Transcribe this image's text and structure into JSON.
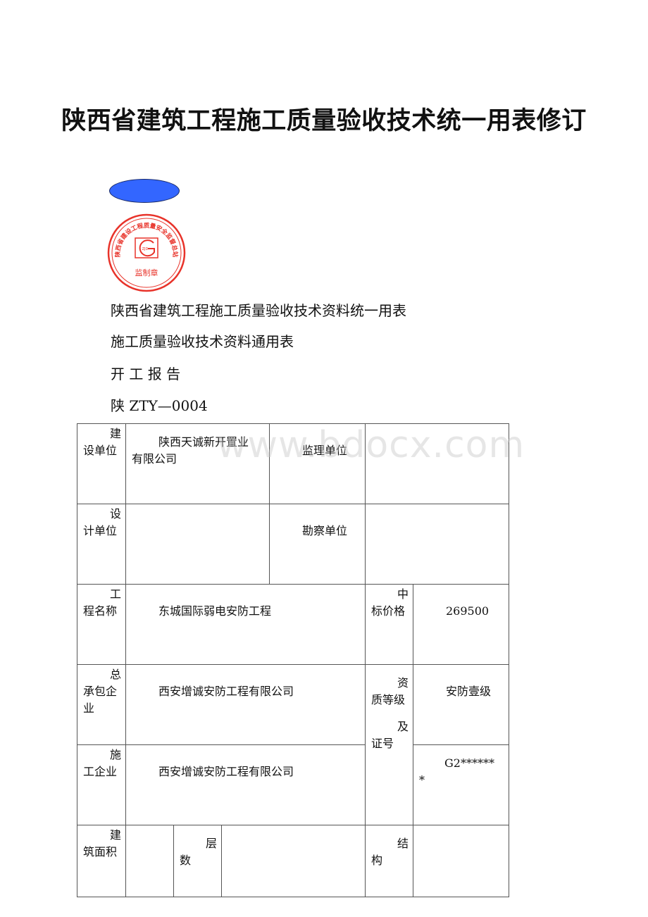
{
  "document": {
    "title": "陕西省建筑工程施工质量验收技术统一用表修订",
    "stamp": {
      "ring_text": "陕西省建设工程质量安全监督总站",
      "logo_text": "ZJD",
      "bottom_text": "监制章",
      "color": "#e8332a"
    },
    "oval_color": "#3366ff",
    "lines": [
      "陕西省建筑工程施工质量验收技术资料统一用表",
      "施工质量验收技术资料通用表",
      "开 工 报 告",
      "陕 ZTY—0004"
    ],
    "watermark": "www.bdocx.com"
  },
  "form": {
    "construction_unit_label": {
      "first": "建",
      "rest": "设单位"
    },
    "construction_unit_value": {
      "first": "陕西天诚新开置业",
      "rest": "有限公司"
    },
    "supervision_unit_label": "监理单位",
    "supervision_unit_value": "",
    "design_unit_label": {
      "first": "设",
      "rest": "计单位"
    },
    "design_unit_value": "",
    "survey_unit_label": "勘察单位",
    "survey_unit_value": "",
    "project_name_label": {
      "first": "工",
      "rest": "程名称"
    },
    "project_name_value": "东城国际弱电安防工程",
    "bid_price_label": {
      "first": "中",
      "rest": "标价格"
    },
    "bid_price_value": "269500",
    "general_contractor_label": {
      "first": "总",
      "rest": "承包企业"
    },
    "general_contractor_value": "西安增诚安防工程有限公司",
    "qualification_label": {
      "first": "资",
      "rest": "质等级"
    },
    "qualification_value": "安防壹级",
    "cert_label": {
      "first": "及",
      "rest": "证号"
    },
    "cert_value": {
      "first": "G2******",
      "rest": "*"
    },
    "builder_label": {
      "first": "施",
      "rest": "工企业"
    },
    "builder_value": "西安增诚安防工程有限公司",
    "area_label": {
      "first": "建",
      "rest": "筑面积"
    },
    "area_value": "",
    "floors_label": {
      "first": "层",
      "rest": "数"
    },
    "floors_value": "",
    "structure_label": {
      "first": "结",
      "rest": "构"
    },
    "structure_value": ""
  }
}
